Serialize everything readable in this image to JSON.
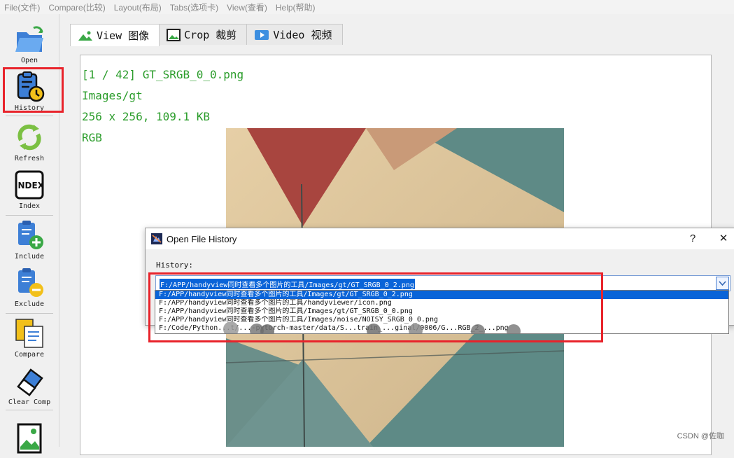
{
  "menu": [
    "File(文件)",
    "Compare(比较)",
    "Layout(布局)",
    "Tabs(选项卡)",
    "View(查看)",
    "Help(帮助)"
  ],
  "toolbar": {
    "open": "Open",
    "history": "History",
    "refresh": "Refresh",
    "index": "Index",
    "index_icon_text": "INDEX",
    "include": "Include",
    "exclude": "Exclude",
    "compare": "Compare",
    "clear_comp": "Clear Comp"
  },
  "tabs": [
    "View 图像",
    "Crop 裁剪",
    "Video 视频"
  ],
  "image_info": {
    "counter": "[1 / 42] GT_SRGB_0_0.png",
    "folder": "Images/gt",
    "size": "256 x 256, 109.1 KB",
    "mode": "RGB"
  },
  "dialog": {
    "title": "Open File History",
    "help": "?",
    "close": "✕",
    "label": "History:",
    "current_value": "F:/APP/handyview同时查看多个图片的工具/Images/gt/GT_SRGB_0_2.png",
    "options": [
      "F:/APP/handyview同时查看多个图片的工具/Images/gt/GT_SRGB_0_2.png",
      "F:/APP/handyview同时查看多个图片的工具/handyviewer/icon.png",
      "F:/APP/handyview同时查看多个图片的工具/Images/gt/GT_SRGB_0_0.png",
      "F:/APP/handyview同时查看多个图片的工具/Images/noise/NOISY_SRGB_0_0.png",
      "F:/Code/Python...t/...-pytorch-master/data/S...train_...ginal/0006/G...RGB_2_...png"
    ]
  },
  "watermark": "CSDN @佐咖",
  "colors": {
    "accent": "#0a64d8",
    "annotation": "#e8232b",
    "info_text": "#2a9c2a"
  }
}
